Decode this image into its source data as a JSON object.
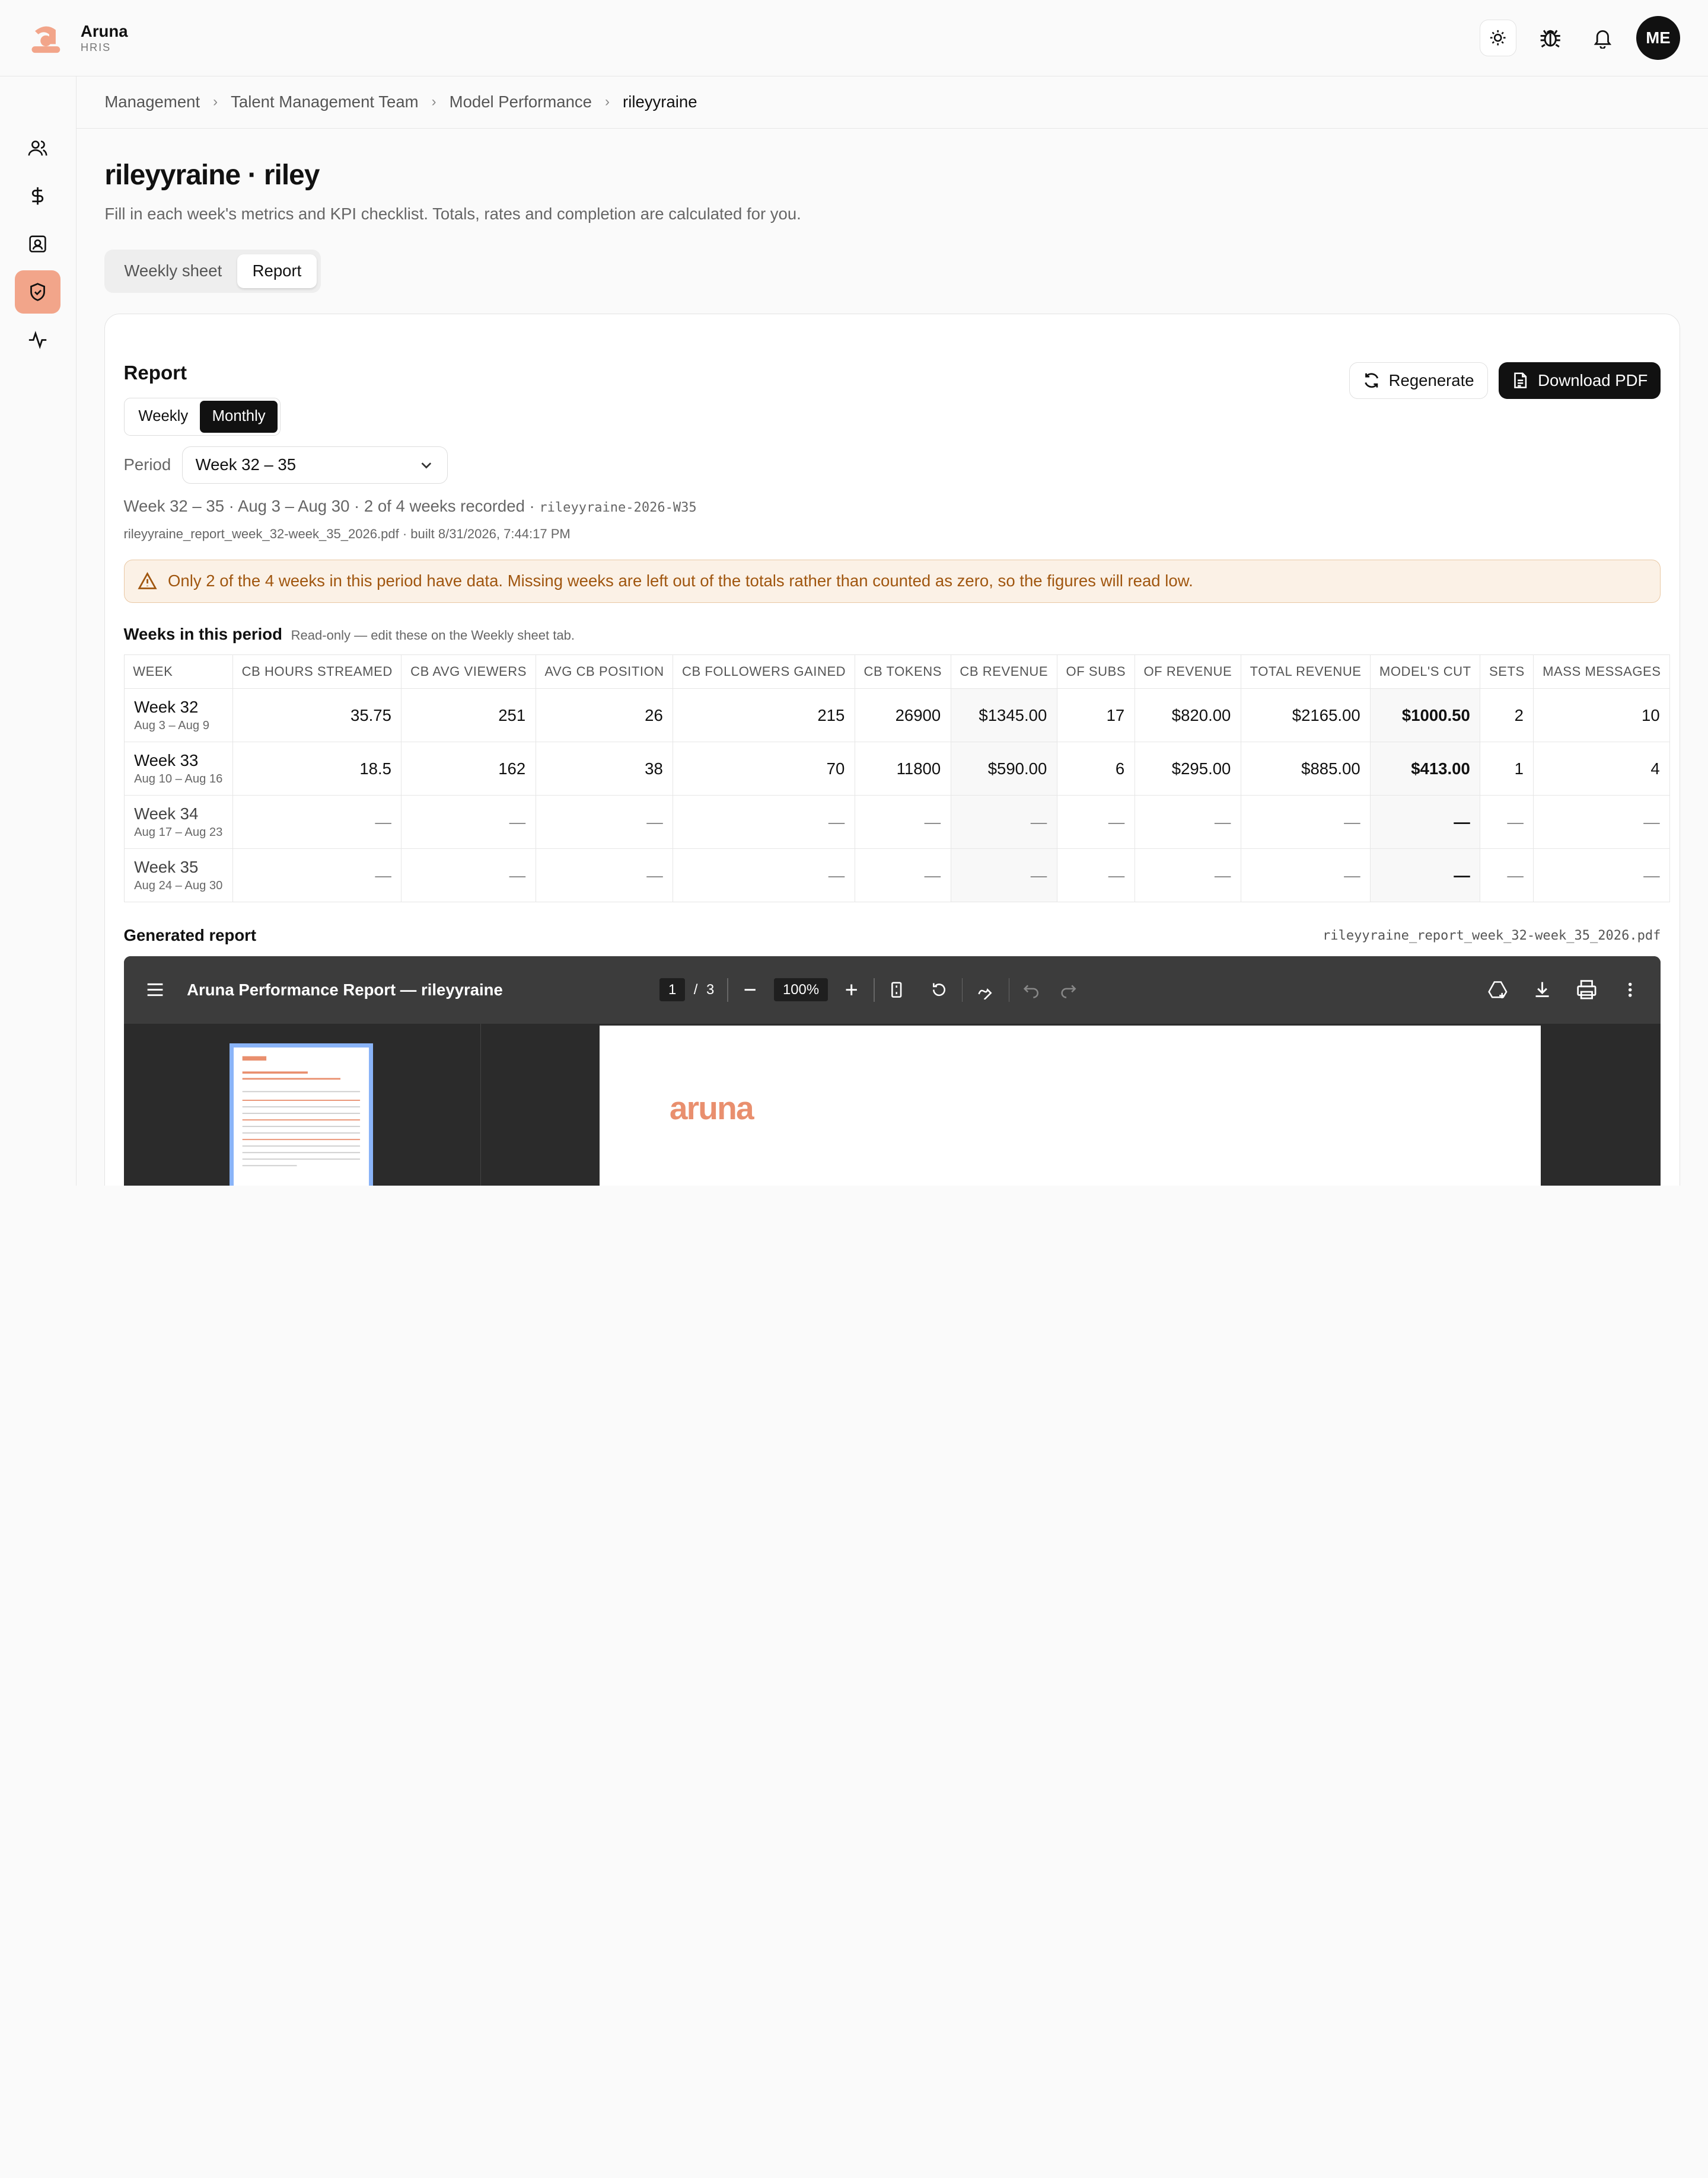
{
  "app": {
    "name": "Aruna",
    "subtitle": "HRIS",
    "user_initials": "ME"
  },
  "header_icons": [
    "sun-icon",
    "bug-icon",
    "bell-icon"
  ],
  "sidebar": {
    "items": [
      "users-icon",
      "dollar-icon",
      "contact-icon",
      "shield-icon",
      "activity-icon"
    ],
    "active_index": 3
  },
  "breadcrumb": [
    "Management",
    "Talent Management Team",
    "Model Performance",
    "rileyyraine"
  ],
  "page": {
    "title": "rileyyraine · riley",
    "subtitle": "Fill in each week's metrics and KPI checklist. Totals, rates and completion are calculated for you.",
    "tabs": [
      "Weekly sheet",
      "Report"
    ],
    "active_tab": "Report"
  },
  "report": {
    "title": "Report",
    "regenerate_label": "Regenerate",
    "download_label": "Download PDF",
    "modes": [
      "Weekly",
      "Monthly"
    ],
    "active_mode": "Monthly",
    "period_label": "Period",
    "period_value": "Week 32 – 35",
    "meta_text": "Week 32 – 35 · Aug 3 – Aug 30 · 2 of 4 weeks recorded · ",
    "meta_code": "rileyyraine-2026-W35",
    "built_text": "rileyyraine_report_week_32-week_35_2026.pdf · built 8/31/2026, 7:44:17 PM",
    "alert": "Only 2 of the 4 weeks in this period have data. Missing weeks are left out of the totals rather than counted as zero, so the figures will read low."
  },
  "weeks_table": {
    "title": "Weeks in this period",
    "note": "Read-only — edit these on the Weekly sheet tab.",
    "columns": [
      "WEEK",
      "CB HOURS STREAMED",
      "CB AVG VIEWERS",
      "AVG CB POSITION",
      "CB FOLLOWERS GAINED",
      "CB TOKENS",
      "CB REVENUE",
      "OF SUBS",
      "OF REVENUE",
      "TOTAL REVENUE",
      "MODEL'S CUT",
      "SETS",
      "MASS MESSAGES"
    ],
    "rows": [
      {
        "week": "Week 32",
        "range": "Aug 3 – Aug 9",
        "values": [
          "35.75",
          "251",
          "26",
          "215",
          "26900",
          "$1345.00",
          "17",
          "$820.00",
          "$2165.00",
          "$1000.50",
          "2",
          "10"
        ]
      },
      {
        "week": "Week 33",
        "range": "Aug 10 – Aug 16",
        "values": [
          "18.5",
          "162",
          "38",
          "70",
          "11800",
          "$590.00",
          "6",
          "$295.00",
          "$885.00",
          "$413.00",
          "1",
          "4"
        ]
      },
      {
        "week": "Week 34",
        "range": "Aug 17 – Aug 23",
        "values": [
          "—",
          "—",
          "—",
          "—",
          "—",
          "—",
          "—",
          "—",
          "—",
          "—",
          "—",
          "—"
        ]
      },
      {
        "week": "Week 35",
        "range": "Aug 24 – Aug 30",
        "values": [
          "—",
          "—",
          "—",
          "—",
          "—",
          "—",
          "—",
          "—",
          "—",
          "—",
          "—",
          "—"
        ]
      }
    ]
  },
  "generated": {
    "title": "Generated report",
    "file": "rileyyraine_report_week_32-week_35_2026.pdf",
    "viewer_title": "Aruna Performance Report — rileyyraine",
    "page_current": "1",
    "page_sep": "/",
    "page_total": "3",
    "zoom": "100%",
    "pdf_logo": "aruna"
  },
  "colors": {
    "accent": "#f2a58a",
    "brand": "#e98f6e",
    "alert_text": "#a0560f"
  }
}
